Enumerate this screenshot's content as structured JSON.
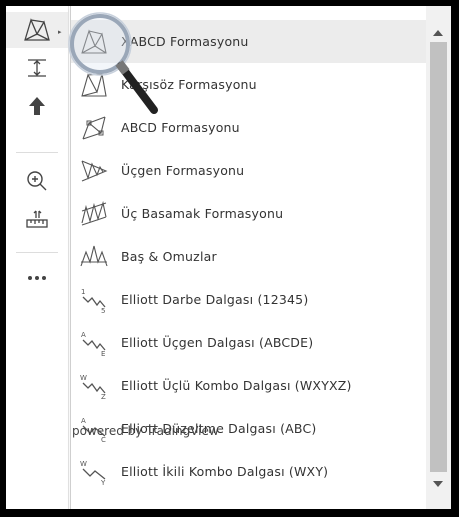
{
  "menu": {
    "items": [
      {
        "label": "XABCD Formasyonu",
        "icon": "xabcd-pattern-icon",
        "selected": true
      },
      {
        "label": "Karşısöz Formasyonu",
        "icon": "cypher-pattern-icon"
      },
      {
        "label": "ABCD Formasyonu",
        "icon": "abcd-pattern-icon"
      },
      {
        "label": "Üçgen Formasyonu",
        "icon": "triangle-pattern-icon"
      },
      {
        "label": "Üç Basamak Formasyonu",
        "icon": "three-drives-pattern-icon"
      },
      {
        "label": "Baş & Omuzlar",
        "icon": "head-shoulders-icon"
      },
      {
        "label": "Elliott Darbe Dalgası (12345)",
        "icon": "elliott-impulse-icon"
      },
      {
        "label": "Elliott Üçgen Dalgası (ABCDE)",
        "icon": "elliott-triangle-icon"
      },
      {
        "label": "Elliott Üçlü Kombo Dalgası (WXYXZ)",
        "icon": "elliott-triple-combo-icon"
      },
      {
        "label": "Elliott Düzeltme Dalgası (ABC)",
        "icon": "elliott-correction-icon"
      },
      {
        "label": "Elliott İkili Kombo Dalgası (WXY)",
        "icon": "elliott-double-combo-icon"
      }
    ]
  },
  "toolbar": {
    "tools": [
      "patterns-icon",
      "measure-icon",
      "arrow-up-icon",
      "zoom-in-icon",
      "ruler-icon",
      "more-icon"
    ]
  },
  "watermark": "powered by TradingView"
}
